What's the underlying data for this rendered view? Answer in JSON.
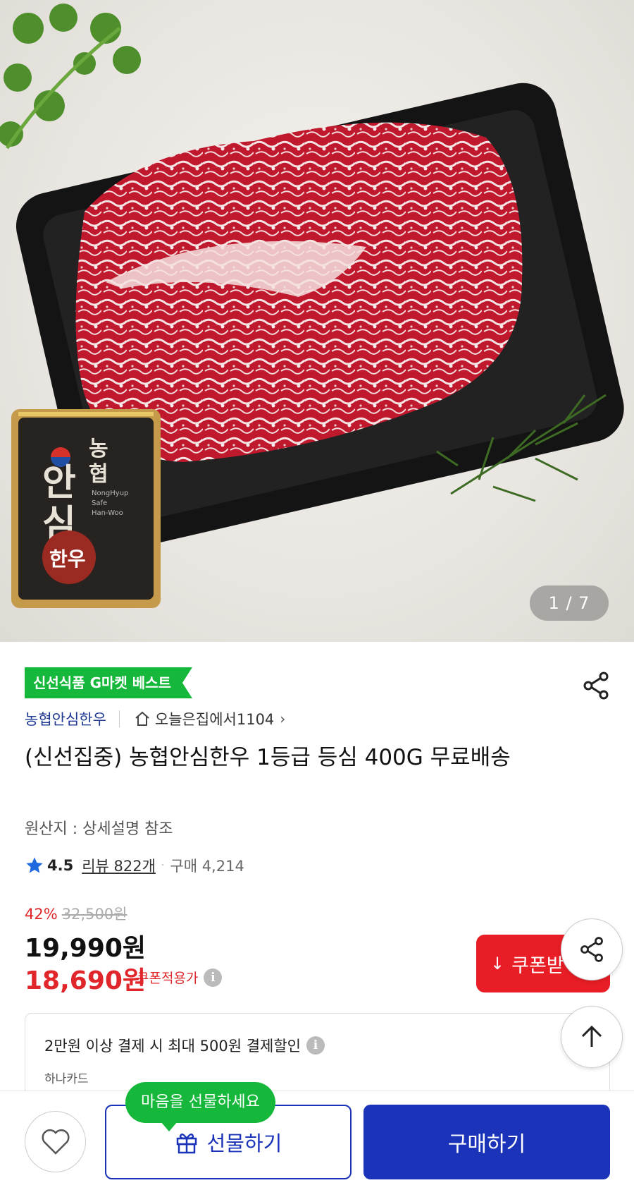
{
  "hero": {
    "image_counter": "1 / 7",
    "seal_brand_top": "농협",
    "seal_brand_main": "안심",
    "seal_brand_en": "NongHyup Safe Han-Woo",
    "seal_hanwoo": "한우"
  },
  "badge": {
    "label": "신선식품 G마켓 베스트"
  },
  "store": {
    "name": "농협안심한우",
    "event_link": "오늘은집에서1104",
    "chevron": "›"
  },
  "product": {
    "title": "(신선집중) 농협안심한우 1등급 등심 400G 무료배송",
    "origin": "원산지 : 상세설명 참조"
  },
  "rating": {
    "score": "4.5",
    "review_label": "리뷰 822개",
    "separator": "·",
    "purchase": "구매 4,214"
  },
  "pricing": {
    "discount_pct": "42%",
    "original_price": "32,500원",
    "price": "19,990원",
    "coupon_price": "18,690원",
    "coupon_label": "쿠폰적용가",
    "info_glyph": "i"
  },
  "coupon_button": {
    "label": "쿠폰받",
    "icon_glyph": "↓"
  },
  "promo": {
    "main_text": "2만원 이상 결제 시 최대 500원 결제할인",
    "card_name": "하나카드",
    "info_glyph": "i"
  },
  "bottom": {
    "tooltip": "마음을 선물하세요",
    "gift_label": "선물하기",
    "buy_label": "구매하기"
  },
  "colors": {
    "accent_green": "#15b83a",
    "brand_blue": "#1a33b8",
    "sale_red": "#e0262a",
    "coupon_red": "#e81d25"
  }
}
